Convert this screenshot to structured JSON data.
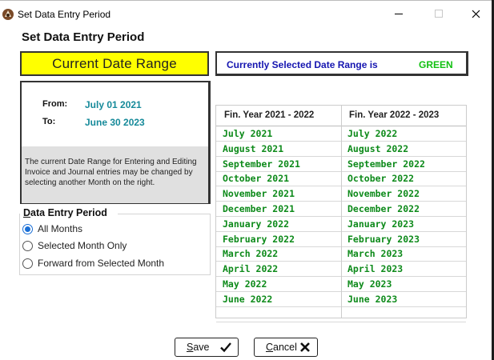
{
  "window": {
    "title": "Set Data Entry Period",
    "icon": "app-logo-icon",
    "controls": [
      "minimize-icon",
      "maximize-icon",
      "close-icon"
    ]
  },
  "heading": "Set Data Entry Period",
  "current_range": {
    "label": "Current Date Range",
    "from_label": "From:",
    "from_value": "July 01 2021",
    "to_label": "To:",
    "to_value": "June 30 2023",
    "note": "The current Date Range for Entering and Editing Invoice and Journal entries may be changed by selecting another Month on the right."
  },
  "selected_range": {
    "text": "Currently Selected Date Range is",
    "color_name": "GREEN",
    "color_hex": "#12c012"
  },
  "period": {
    "legend_underlined": "D",
    "legend_rest": "ata Entry Period",
    "options": [
      {
        "label": "All Months",
        "selected": true
      },
      {
        "label": "Selected Month Only",
        "selected": false
      },
      {
        "label": "Forward from Selected Month",
        "selected": false
      }
    ]
  },
  "months_table": {
    "headers": [
      "Fin. Year 2021 - 2022",
      "Fin. Year 2022 - 2023"
    ],
    "col1": [
      "July 2021",
      "August 2021",
      "September 2021",
      "October 2021",
      "November 2021",
      "December 2021",
      "January 2022",
      "February 2022",
      "March 2022",
      "April 2022",
      "May 2022",
      "June 2022",
      ""
    ],
    "col2": [
      "July 2022",
      "August 2022",
      "September 2022",
      "October 2022",
      "November 2022",
      "December 2022",
      "January 2023",
      "February 2023",
      "March 2023",
      "April 2023",
      "May 2023",
      "June 2023",
      ""
    ]
  },
  "buttons": {
    "save_u": "S",
    "save_rest": "ave",
    "save_icon": "checkmark-icon",
    "cancel_u": "C",
    "cancel_rest": "ancel",
    "cancel_icon": "x-icon"
  }
}
